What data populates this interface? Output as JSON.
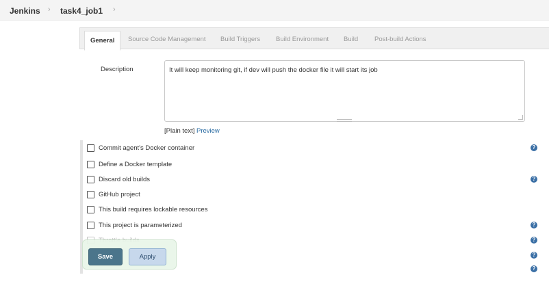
{
  "breadcrumb": {
    "items": [
      "Jenkins",
      "task4_job1"
    ],
    "separator": "›"
  },
  "tabs": [
    {
      "label": "General",
      "active": true
    },
    {
      "label": "Source Code Management",
      "active": false
    },
    {
      "label": "Build Triggers",
      "active": false
    },
    {
      "label": "Build Environment",
      "active": false
    },
    {
      "label": "Build",
      "active": false
    },
    {
      "label": "Post-build Actions",
      "active": false
    }
  ],
  "description": {
    "label": "Description",
    "value": "It will keep monitoring git, if dev will push the docker file it will start its job",
    "plain_text": "[Plain text]",
    "preview_link": "Preview"
  },
  "options": [
    {
      "label": "Commit agent's Docker container",
      "checked": false,
      "help": true
    },
    {
      "label": "Define a Docker template",
      "checked": false,
      "help": false
    },
    {
      "label": "Discard old builds",
      "checked": false,
      "help": true
    },
    {
      "label": "GitHub project",
      "checked": false,
      "help": false
    },
    {
      "label": "This build requires lockable resources",
      "checked": false,
      "help": false
    },
    {
      "label": "This project is parameterized",
      "checked": false,
      "help": true
    },
    {
      "label": "Throttle builds",
      "checked": false,
      "help": true
    }
  ],
  "help_glyph": "?",
  "buttons": {
    "save": "Save",
    "apply": "Apply"
  },
  "colors": {
    "save_bg": "#4b758b",
    "apply_bg": "#c7d8ec",
    "link": "#2b6ca3",
    "help_icon": "#3a6fa5"
  }
}
